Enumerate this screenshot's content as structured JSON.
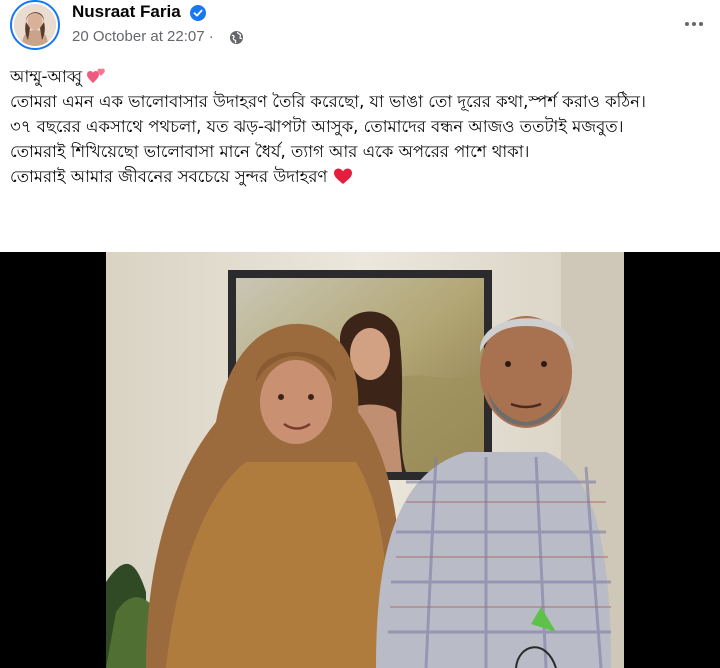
{
  "post": {
    "author": "Nusraat Faria",
    "timestamp": "20 October at 22:07",
    "meta_separator": "·",
    "verified": true,
    "privacy": "globe-icon",
    "text": {
      "line1": "আম্মু-আব্বু",
      "line2": "তোমরা এমন এক ভালোবাসার উদাহরণ তৈরি করেছো, যা ভাঙা তো দূরের কথা,স্পর্শ করাও কঠিন।",
      "line3": "৩৭ বছরের একসাথে পথচলা, যত ঝড়-ঝাপটা আসুক, তোমাদের বন্ধন আজও ততটাই মজবুত।",
      "line4": "তোমরাই শিখিয়েছো ভালোবাসা মানে ধৈর্য, ত্যাগ আর একে অপরের পাশে থাকা।",
      "line5": "তোমরাই আমার জীবনের সবচেয়ে সুন্দর উদাহরণ"
    }
  },
  "colors": {
    "accent": "#1877f2",
    "secondary_text": "#65676b",
    "heart": "#e41e3f",
    "media_background": "#000000"
  },
  "icons": [
    "verified-badge-icon",
    "globe-icon",
    "more-options-icon",
    "two-hearts-emoji",
    "red-heart-emoji"
  ]
}
